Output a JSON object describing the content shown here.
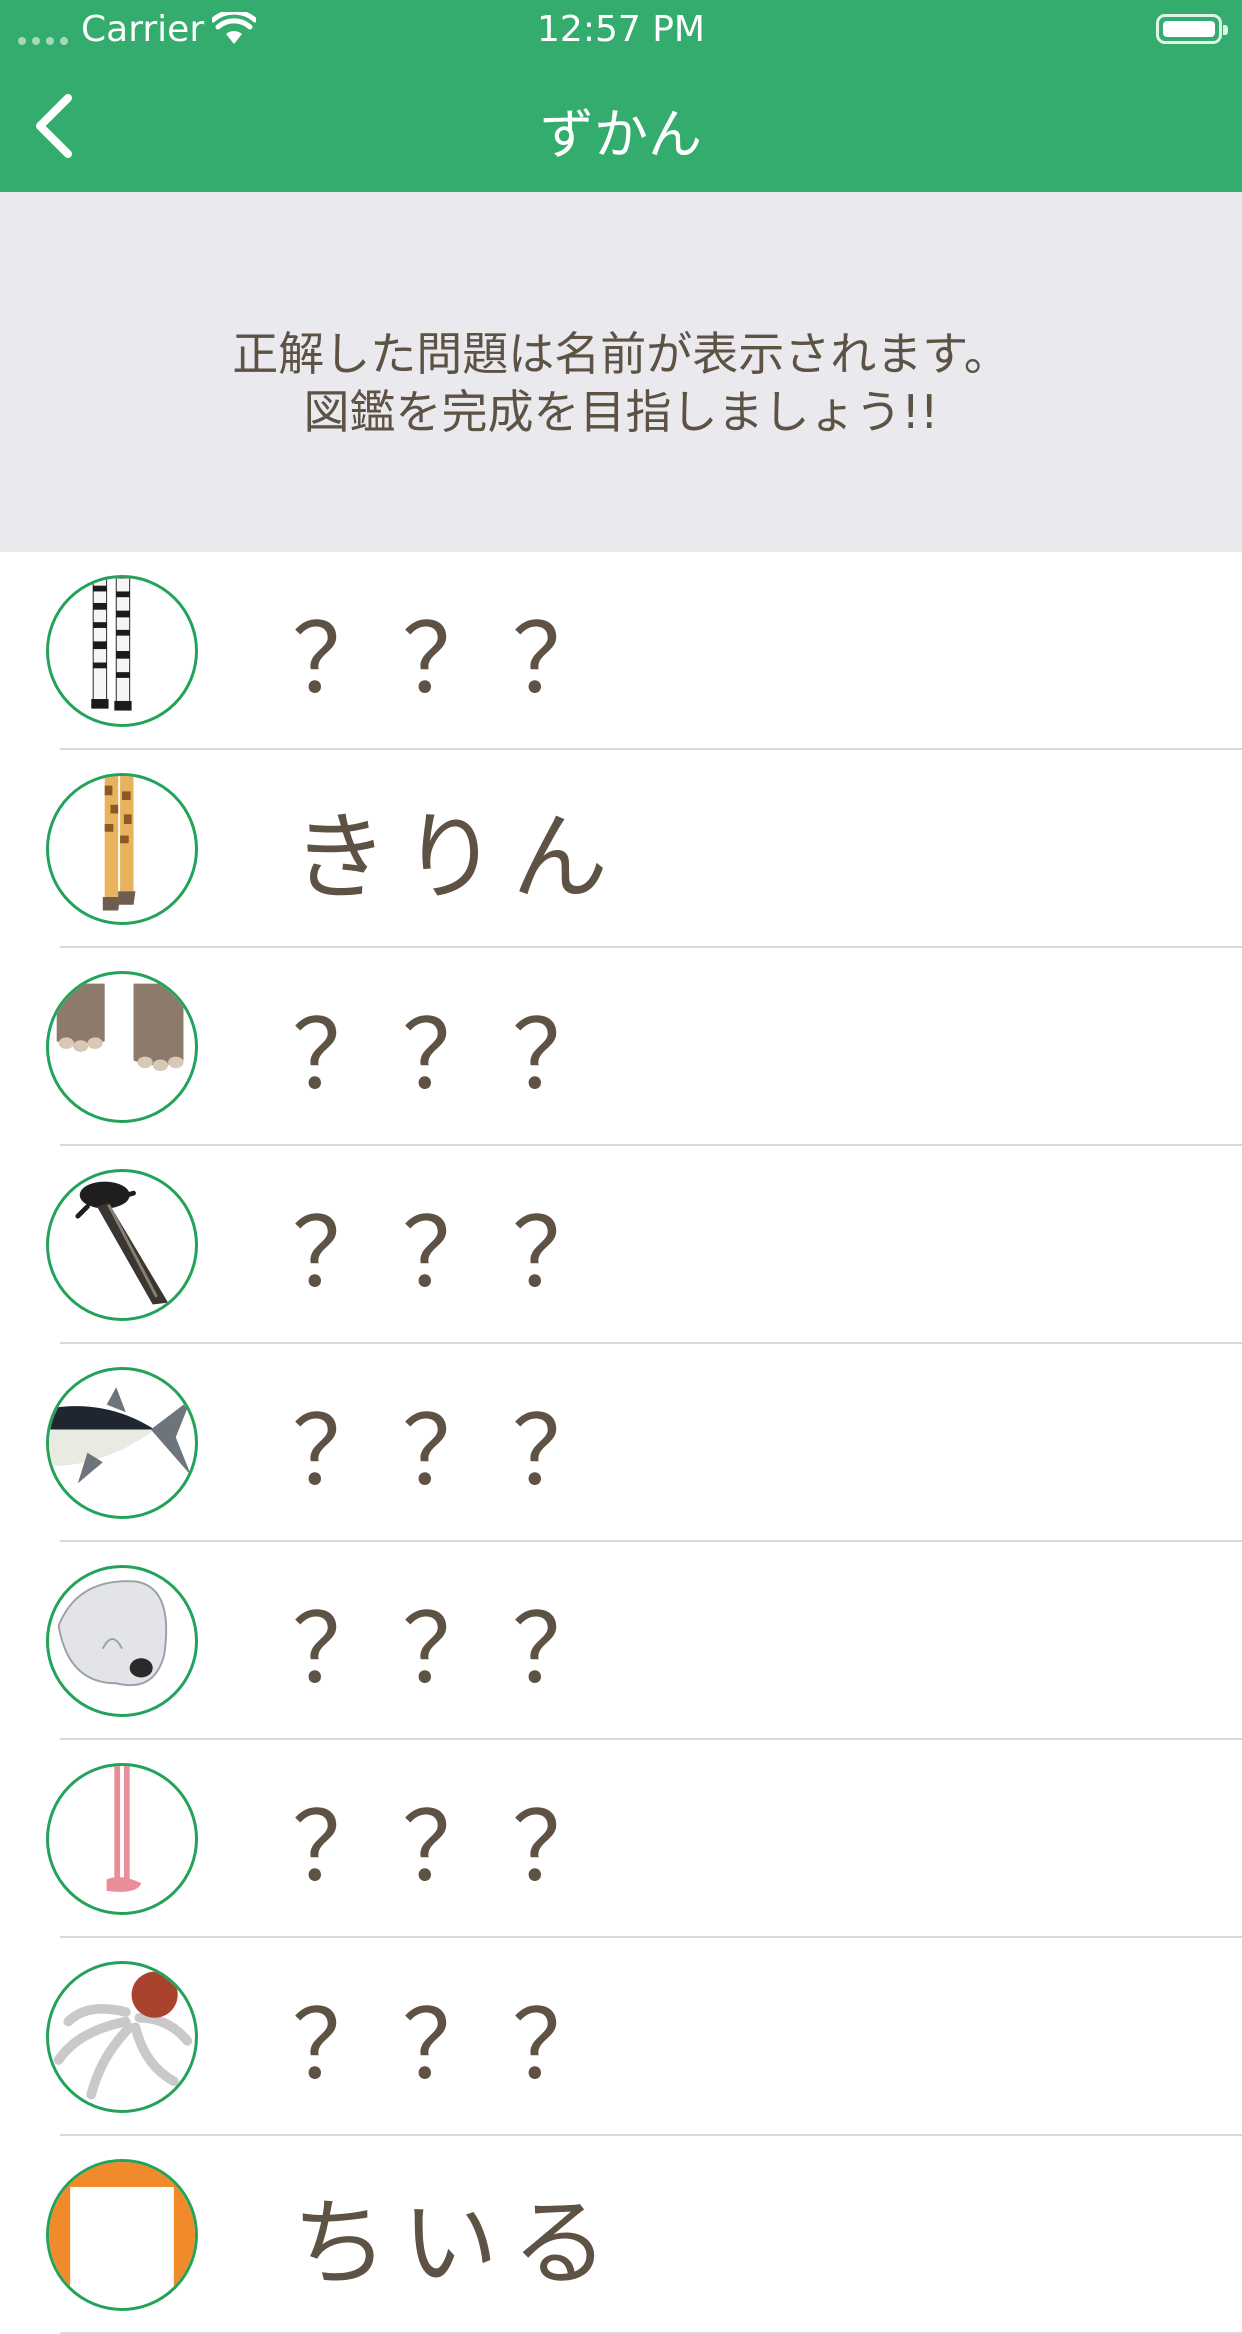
{
  "status_bar": {
    "carrier": "Carrier",
    "time": "12:57 PM"
  },
  "nav": {
    "title": "ずかん",
    "back_icon": "chevron-left-icon"
  },
  "banner": {
    "line1": "正解した問題は名前が表示されます。",
    "line2": "図鑑を完成を目指しましょう!!"
  },
  "colors": {
    "accent": "#34ac6e",
    "text": "#5d5244",
    "ring": "#23a35a",
    "banner_bg": "#e9e9ee"
  },
  "items": [
    {
      "label": "？？？",
      "icon": "zebra-legs-icon"
    },
    {
      "label": "きりん",
      "icon": "giraffe-legs-icon"
    },
    {
      "label": "？？？",
      "icon": "elephant-feet-icon"
    },
    {
      "label": "？？？",
      "icon": "platypus-tail-icon"
    },
    {
      "label": "？？？",
      "icon": "tuna-fish-icon"
    },
    {
      "label": "？？？",
      "icon": "white-animal-paw-icon"
    },
    {
      "label": "？？？",
      "icon": "flamingo-leg-icon"
    },
    {
      "label": "？？？",
      "icon": "octopus-icon"
    },
    {
      "label": "ちいる",
      "icon": "orange-animal-icon"
    }
  ]
}
